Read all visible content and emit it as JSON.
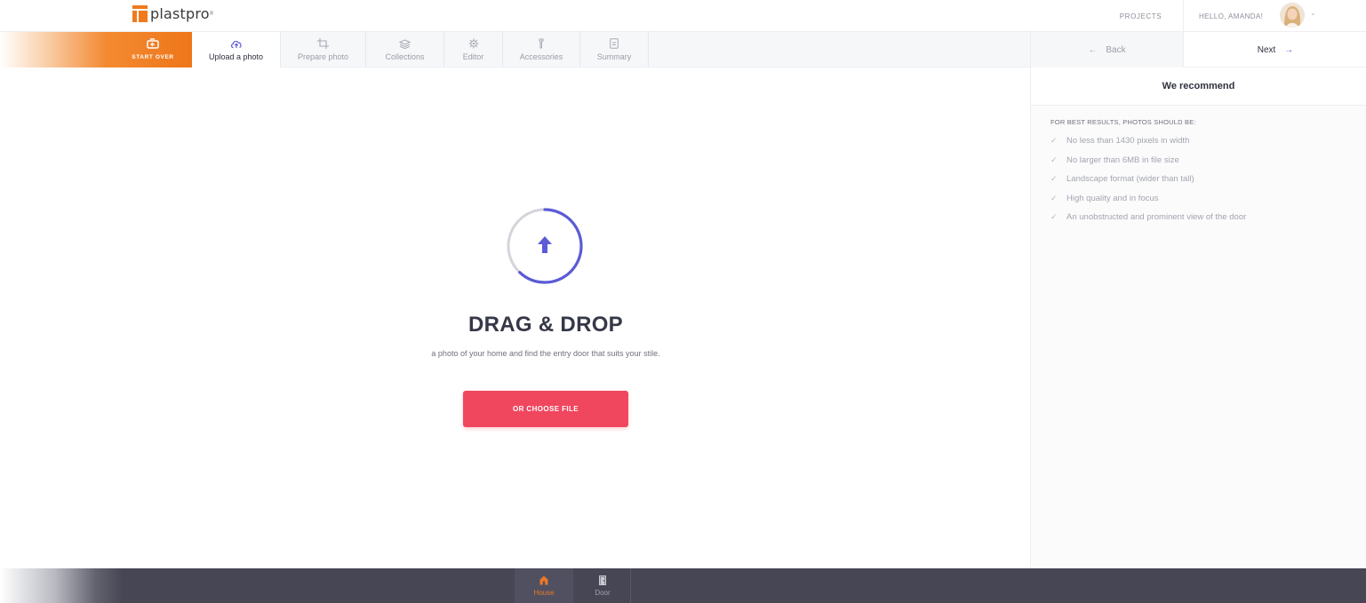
{
  "header": {
    "logo_text": "plastpro",
    "projects_label": "PROJECTS",
    "greeting": "HELLO, AMANDA!",
    "avatar_icon": "user-avatar"
  },
  "steps": {
    "start_over_label": "START OVER",
    "items": [
      {
        "label": "Upload a photo",
        "icon": "cloud-upload-icon",
        "active": true
      },
      {
        "label": "Prepare photo",
        "icon": "crop-icon",
        "active": false
      },
      {
        "label": "Collections",
        "icon": "layers-icon",
        "active": false
      },
      {
        "label": "Editor",
        "icon": "gear-icon",
        "active": false
      },
      {
        "label": "Accessories",
        "icon": "handle-icon",
        "active": false
      },
      {
        "label": "Summary",
        "icon": "document-icon",
        "active": false
      }
    ]
  },
  "nav": {
    "back_label": "Back",
    "next_label": "Next"
  },
  "upload": {
    "title": "DRAG & DROP",
    "subtitle": "a photo of your home and find the entry door that suits your stile.",
    "choose_label": "OR CHOOSE FILE",
    "progress": 0.62
  },
  "recommend": {
    "title": "We recommend",
    "subtitle": "FOR BEST RESULTS, PHOTOS SHOULD BE:",
    "items": [
      "No less than 1430 pixels in width",
      "No larger than 6MB in file size",
      "Landscape format (wider than tall)",
      "High quality and in focus",
      "An unobstructed and prominent view of the door"
    ]
  },
  "bottom_tabs": {
    "house_label": "House",
    "door_label": "Door"
  },
  "colors": {
    "accent_orange": "#ee7619",
    "accent_purple": "#5b5bd6",
    "cta_red": "#f0465e",
    "bottom_bar": "#464654"
  }
}
